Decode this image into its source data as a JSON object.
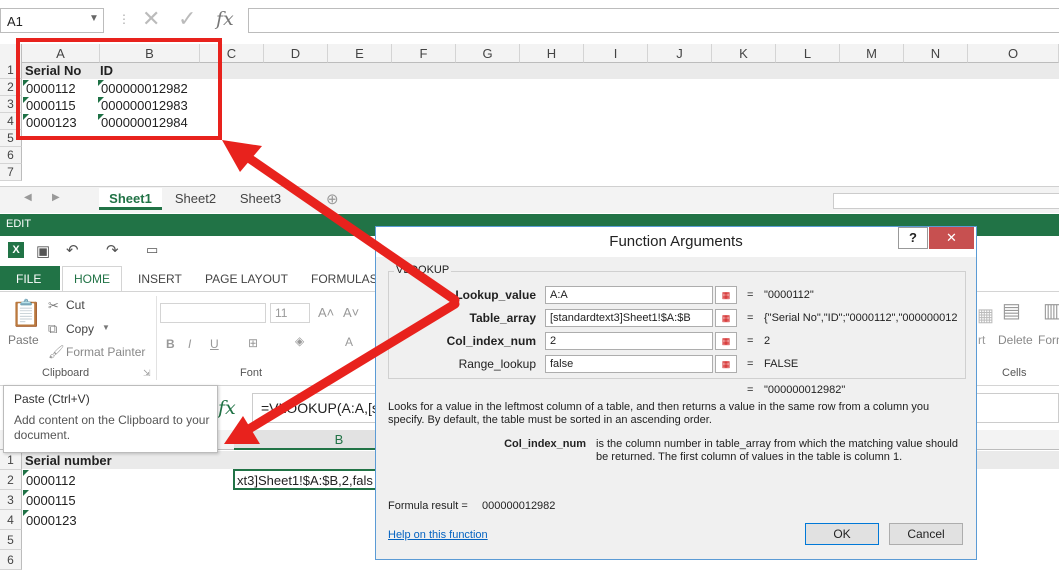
{
  "top_sheet": {
    "name_box": "A1",
    "fx": "fx",
    "columns": [
      "A",
      "B",
      "C",
      "D",
      "E",
      "F",
      "G",
      "H",
      "I",
      "J",
      "K",
      "L",
      "M",
      "N",
      "O"
    ],
    "rows": [
      "1",
      "2",
      "3",
      "4",
      "5",
      "6",
      "7"
    ],
    "headers": [
      "Serial No",
      "ID"
    ],
    "data": [
      [
        "0000112",
        "000000012982"
      ],
      [
        "0000115",
        "000000012983"
      ],
      [
        "0000123",
        "000000012984"
      ]
    ],
    "tabs": [
      "Sheet1",
      "Sheet2",
      "Sheet3"
    ]
  },
  "status": "EDIT",
  "ribbon": {
    "tabs": [
      "FILE",
      "HOME",
      "INSERT",
      "PAGE LAYOUT",
      "FORMULAS"
    ],
    "paste": "Paste",
    "cut": "Cut",
    "copy": "Copy",
    "format_painter": "Format Painter",
    "clipboard": "Clipboard",
    "font": "Font",
    "font_size": "11",
    "bold": "B",
    "italic": "I",
    "underline": "U",
    "delete": "Delete",
    "format": "Form",
    "insert_partial": "rt",
    "cells": "Cells"
  },
  "tooltip": {
    "title": "Paste (Ctrl+V)",
    "body": "Add content on the Clipboard to your document."
  },
  "bottom_sheet": {
    "fx": "fx",
    "formula_partial": "=VLOOKUP(A:A,[st",
    "col_b": "B",
    "rows": [
      "1",
      "2",
      "3",
      "4",
      "5",
      "6"
    ],
    "header": "Serial number",
    "data": [
      "0000112",
      "0000115",
      "0000123"
    ],
    "b2": "xt3]Sheet1!$A:$B,2,fals"
  },
  "dialog": {
    "title": "Function Arguments",
    "help_btn": "?",
    "close_btn": "✕",
    "group": "VLOOKUP",
    "args": [
      {
        "label": "Lookup_value",
        "value": "A:A",
        "result": "\"0000112\""
      },
      {
        "label": "Table_array",
        "value": "[standardtext3]Sheet1!$A:$B",
        "result": "{\"Serial No\",\"ID\";\"0000112\",\"000000012"
      },
      {
        "label": "Col_index_num",
        "value": "2",
        "result": "2"
      },
      {
        "label": "Range_lookup",
        "value": "false",
        "result": "FALSE"
      }
    ],
    "eq": "=",
    "total_result": "\"000000012982\"",
    "description": "Looks for a value in the leftmost column of a table, and then returns a value in the same row from a column you specify. By default, the table must be sorted in an ascending order.",
    "arg_name": "Col_index_num",
    "arg_desc": "is the column number in table_array from which the matching value should be returned. The first column of values in the table is column 1.",
    "formula_result_label": "Formula result =",
    "formula_result_value": "000000012982",
    "help_link": "Help on this function",
    "ok": "OK",
    "cancel": "Cancel"
  },
  "colors": {
    "excel_green": "#217346",
    "highlight_red": "#e8221d",
    "dialog_border": "#5b9bd5"
  }
}
